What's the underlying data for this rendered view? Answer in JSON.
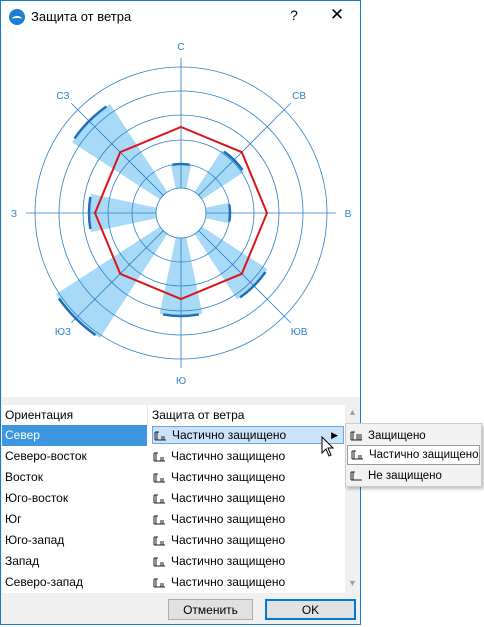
{
  "window": {
    "title": "Защита от ветра",
    "help_label": "?",
    "close_label": "✕"
  },
  "wind_rose": {
    "labels": {
      "n": "С",
      "ne": "СВ",
      "e": "В",
      "se": "ЮВ",
      "s": "Ю",
      "sw": "ЮЗ",
      "w": "З",
      "nw": "СЗ"
    },
    "colors": {
      "ring": "#2a7fc6",
      "petal": "#a8daf7",
      "rim": "#1f6fb8",
      "polygon": "#d9161c"
    }
  },
  "table": {
    "headers": {
      "orientation": "Ориентация",
      "protection": "Защита от ветра"
    },
    "rows": [
      {
        "orientation": "Север",
        "protection": "Частично защищено"
      },
      {
        "orientation": "Северо-восток",
        "protection": "Частично защищено"
      },
      {
        "orientation": "Восток",
        "protection": "Частично защищено"
      },
      {
        "orientation": "Юго-восток",
        "protection": "Частично защищено"
      },
      {
        "orientation": "Юг",
        "protection": "Частично защищено"
      },
      {
        "orientation": "Юго-запад",
        "protection": "Частично защищено"
      },
      {
        "orientation": "Запад",
        "protection": "Частично защищено"
      },
      {
        "orientation": "Северо-запад",
        "protection": "Частично защищено"
      }
    ],
    "scroll_up": "▲",
    "scroll_down": "▼",
    "submenu_arrow": "▶"
  },
  "popup_menu": {
    "items": [
      {
        "label": "Защищено"
      },
      {
        "label": "Частично защищено"
      },
      {
        "label": "Не защищено"
      }
    ]
  },
  "buttons": {
    "cancel": "Отменить",
    "ok": "OK"
  }
}
